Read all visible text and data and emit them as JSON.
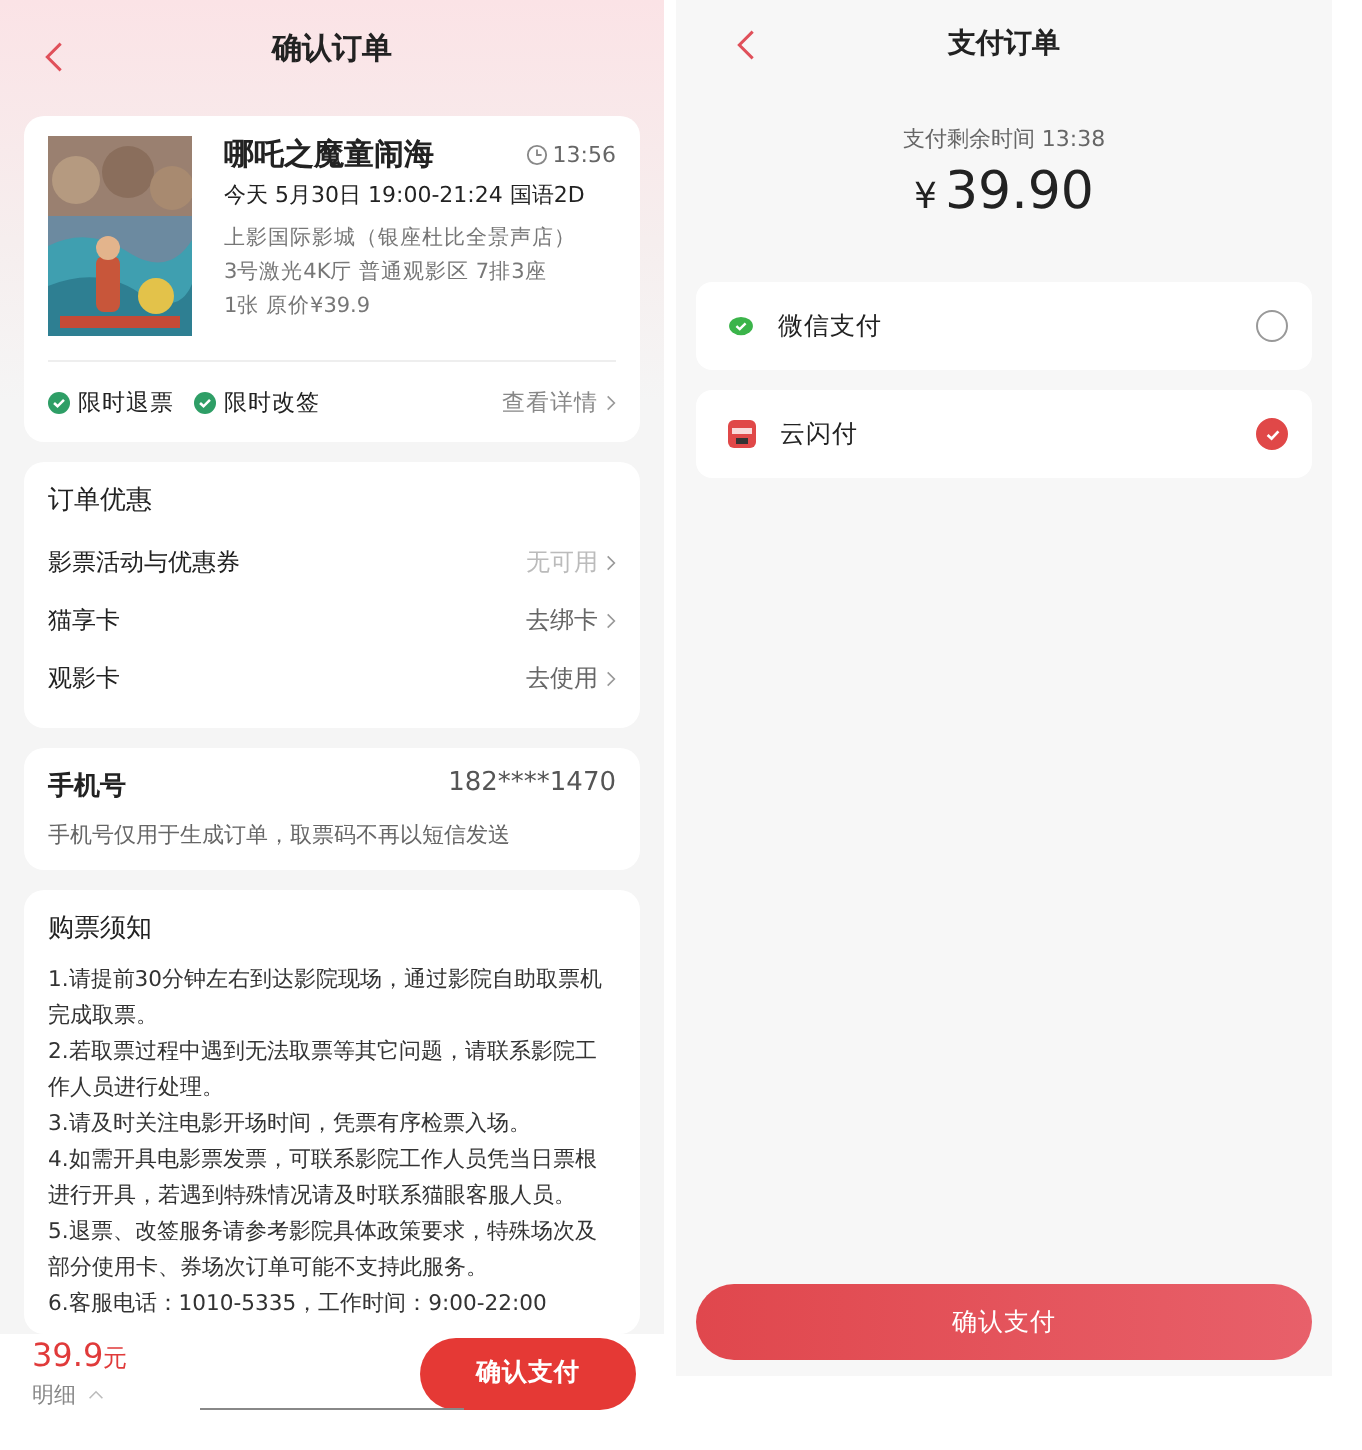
{
  "confirm_screen": {
    "title": "确认订单",
    "movie": {
      "title": "哪吒之魔童闹海",
      "countdown": "13:56",
      "showtime": "今天 5月30日 19:00-21:24 国语2D",
      "cinema": "上影国际影城（银座杜比全景声店）",
      "hall": "3号激光4K厅 普通观影区 7排3座",
      "price_line": "1张 原价¥39.9",
      "badges": [
        "限时退票",
        "限时改签"
      ],
      "details_link": "查看详情"
    },
    "discounts": {
      "title": "订单优惠",
      "rows": [
        {
          "label": "影票活动与优惠券",
          "action": "无可用",
          "disabled": true
        },
        {
          "label": "猫享卡",
          "action": "去绑卡",
          "disabled": false
        },
        {
          "label": "观影卡",
          "action": "去使用",
          "disabled": false
        }
      ]
    },
    "phone": {
      "title": "手机号",
      "number": "182****1470",
      "note": "手机号仅用于生成订单，取票码不再以短信发送"
    },
    "notice": {
      "title": "购票须知",
      "items": [
        "1.请提前30分钟左右到达影院现场，通过影院自助取票机完成取票。",
        "2.若取票过程中遇到无法取票等其它问题，请联系影院工作人员进行处理。",
        "3.请及时关注电影开场时间，凭票有序检票入场。",
        "4.如需开具电影票发票，可联系影院工作人员凭当日票根进行开具，若遇到特殊情况请及时联系猫眼客服人员。",
        "5.退票、改签服务请参考影院具体政策要求，特殊场次及部分使用卡、券场次订单可能不支持此服务。",
        "6.客服电话：1010-5335，工作时间：9:00-22:00"
      ]
    },
    "footer": {
      "price": "39.9",
      "unit": "元",
      "details": "明细",
      "button": "确认支付"
    }
  },
  "pay_screen": {
    "title": "支付订单",
    "timer": "支付剩余时间 13:38",
    "currency": "¥",
    "amount": "39.90",
    "methods": [
      {
        "name": "微信支付",
        "kind": "wechat",
        "selected": false
      },
      {
        "name": "云闪付",
        "kind": "unionpay",
        "selected": true
      }
    ],
    "button": "确认支付"
  }
}
